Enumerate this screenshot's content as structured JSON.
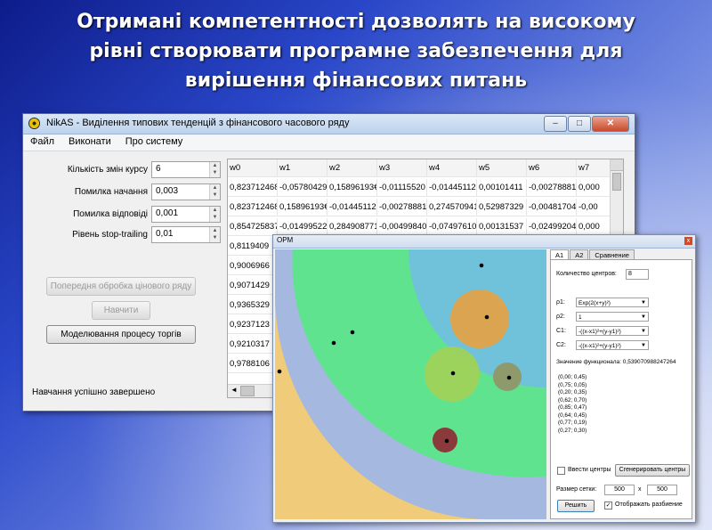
{
  "slide": {
    "heading_lines": [
      "Отримані компетентності дозволять на високому",
      "рівні створювати програмне забезпечення для",
      "вирішення фінансових  питань"
    ]
  },
  "main_window": {
    "title": "NikAS - Виділення типових тенденцій з фінансового часового ряду",
    "window_controls": {
      "minimize": "–",
      "maximize": "□",
      "close": "✕"
    },
    "menu": [
      "Файл",
      "Виконати",
      "Про систему"
    ],
    "params": [
      {
        "label": "Кількість змін курсу",
        "value": "6"
      },
      {
        "label": "Помилка начання",
        "value": "0,003"
      },
      {
        "label": "Помилка відповіді",
        "value": "0,001"
      },
      {
        "label": "Рівень stop-trailing",
        "value": "0,01"
      }
    ],
    "buttons": {
      "preprocess": "Попередня обробка цінового ряду",
      "train": "Навчити",
      "simulate": "Моделювання процесу торгів"
    },
    "status": "Навчання успішно завершено",
    "grid": {
      "columns": [
        "w0",
        "w1",
        "w2",
        "w3",
        "w4",
        "w5",
        "w6",
        "w7"
      ],
      "rows": [
        [
          "0,823712468",
          "-0,05780429",
          "0,15896193€",
          "-0,01115520",
          "-0,01445112",
          "0,00101411",
          "-0,00278881",
          "0,000"
        ],
        [
          "0,823712468",
          "0,15896193€",
          "-0,01445112",
          "-0,00278881",
          "0,274570941",
          "0,52987329",
          "-0,00481704",
          "-0,00"
        ],
        [
          "0,854725837",
          "-0,01499522",
          "0,284908771",
          "-0,00499840",
          "-0,07497610",
          "0,00131537",
          "-0,02499204",
          "0,000"
        ],
        [
          "0,8119409",
          "",
          "",
          "",
          "",
          "",
          "",
          ""
        ],
        [
          "0,9006966",
          "",
          "",
          "",
          "",
          "",
          "",
          ""
        ],
        [
          "0,9071429",
          "",
          "",
          "",
          "",
          "",
          "",
          ""
        ],
        [
          "0,9365329",
          "",
          "",
          "",
          "",
          "",
          "",
          ""
        ],
        [
          "0,9237123",
          "",
          "",
          "",
          "",
          "",
          "",
          ""
        ],
        [
          "0,9210317",
          "",
          "",
          "",
          "",
          "",
          "",
          ""
        ],
        [
          "0,9788106",
          "",
          "",
          "",
          "",
          "",
          "",
          ""
        ]
      ]
    }
  },
  "opm_window": {
    "title": "ОРМ",
    "close": "x",
    "tabs": [
      "A1",
      "A2",
      "Сравнение"
    ],
    "centers_label": "Количество центров:",
    "centers_value": "8",
    "combos": [
      {
        "label": "ρ1:",
        "value": "Exp(2(x+y)²)"
      },
      {
        "label": "ρ2:",
        "value": "1"
      },
      {
        "label": "C1:",
        "value": "-((x-x1)²+(y-y1)²)"
      },
      {
        "label": "C2:",
        "value": "-((x-x1)²+(y-y1)²)"
      }
    ],
    "functional": "Значение функционала: 0,539070988247264",
    "centers_list": [
      "(0,00; 0,45)",
      "(0,75; 0,05)",
      "(0,20; 0,35)",
      "(0,62; 0,70)",
      "(0,85; 0,47)",
      "(0,64; 0,45)",
      "(0,77; 0,19)",
      "(0,27; 0,30)"
    ],
    "checkbox_enter": "Ввести центры",
    "generate_button": "Сгенерировать центры",
    "grid_size_label": "Размер сетки:",
    "grid_w": "500",
    "grid_x": "x",
    "grid_h": "500",
    "solve_button": "Решить",
    "checkbox_show": "Отображать разбиение",
    "checkbox_show_mark": "✓",
    "region_colors": [
      "#f0cb7a",
      "#a5b8e0",
      "#5fe38f",
      "#6fc2d9",
      "#e0a24a",
      "#9ed25a",
      "#8e9a6b",
      "#8a3a3a"
    ]
  }
}
